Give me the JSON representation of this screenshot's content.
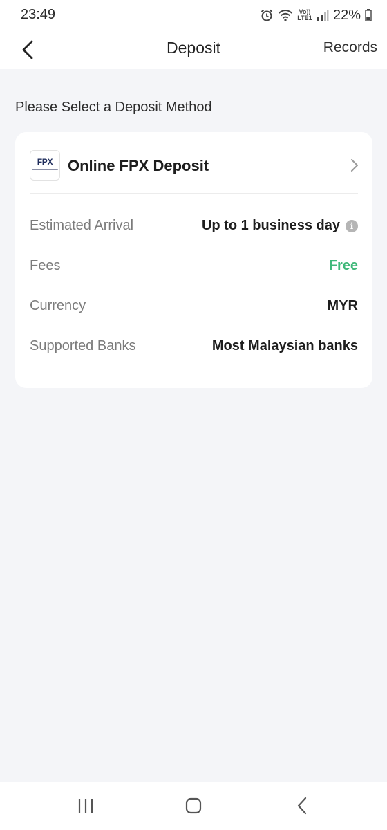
{
  "status_bar": {
    "time": "23:49",
    "network_label": "Vo)) LTE1",
    "battery": "22%",
    "icons": [
      "alarm-icon",
      "wifi-icon",
      "volte-icon",
      "signal-icon",
      "battery-icon"
    ]
  },
  "header": {
    "title": "Deposit",
    "records_label": "Records",
    "back_icon": "chevron-left-icon"
  },
  "section_title": "Please Select a Deposit Method",
  "deposit_method": {
    "logo_text": "FPX",
    "name": "Online FPX Deposit",
    "details": [
      {
        "label": "Estimated Arrival",
        "value": "Up to 1 business day",
        "has_info_icon": true
      },
      {
        "label": "Fees",
        "value": "Free"
      },
      {
        "label": "Currency",
        "value": "MYR"
      },
      {
        "label": "Supported Banks",
        "value": "Most Malaysian banks"
      }
    ]
  },
  "colors": {
    "background": "#f4f5f8",
    "card": "#ffffff",
    "free_green": "#3fb879",
    "label_gray": "#7b7b7b"
  },
  "nav_bar": {
    "icons": [
      "recent-apps-icon",
      "home-icon",
      "back-icon"
    ]
  }
}
